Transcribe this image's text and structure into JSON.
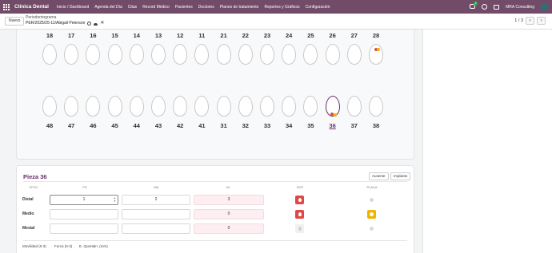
{
  "navbar": {
    "brand": "Clínica Dental",
    "menu": [
      "Inicio / Dashboard",
      "Agenda del Día",
      "Citas",
      "Record Médico",
      "Pacientes",
      "Doctores",
      "Planes de tratamiento",
      "Reportes y Gráficos",
      "Configuración"
    ],
    "chat_badge": "4",
    "company": "MRA Consulting"
  },
  "control": {
    "new_label": "Nuevo",
    "breadcrumb_parent": "Periodontograma",
    "breadcrumb_current": "PER/2025/25-11/Abigail Peterson",
    "pager_value": "1 / 3",
    "prev": "‹",
    "next": "›"
  },
  "odontogram": {
    "upper_teeth": [
      "18",
      "17",
      "16",
      "15",
      "14",
      "13",
      "12",
      "11",
      "21",
      "22",
      "23",
      "24",
      "25",
      "26",
      "27",
      "28"
    ],
    "lower_teeth": [
      "48",
      "47",
      "46",
      "45",
      "44",
      "43",
      "42",
      "41",
      "31",
      "32",
      "33",
      "34",
      "35",
      "36",
      "37",
      "38"
    ],
    "selected_tooth": "36",
    "colors": {
      "bleeding": "#e04848",
      "plaque": "#f0b400",
      "selected_outline": "#6a2d6a"
    }
  },
  "detail": {
    "title": "Pieza 36",
    "btn_absent": "Ausente",
    "btn_implant": "Implante",
    "columns": [
      "SITIO",
      "PS",
      "GM",
      "NI",
      "SGP",
      "PLACA"
    ],
    "rows": [
      {
        "site": "Distal",
        "ps": "1",
        "gm": "2",
        "ni": "3",
        "bleeding": "red",
        "plaque": "grey"
      },
      {
        "site": "Medio",
        "ps": "",
        "gm": "",
        "ni": "0",
        "bleeding": "red",
        "plaque": "yellow"
      },
      {
        "site": "Mesial",
        "ps": "",
        "gm": "",
        "ni": "0",
        "bleeding": "grey",
        "plaque": "grey"
      }
    ],
    "legend": [
      "Movilidad (0-3)",
      "Furca (0-3)",
      "E. Queratin. (mm)"
    ]
  }
}
